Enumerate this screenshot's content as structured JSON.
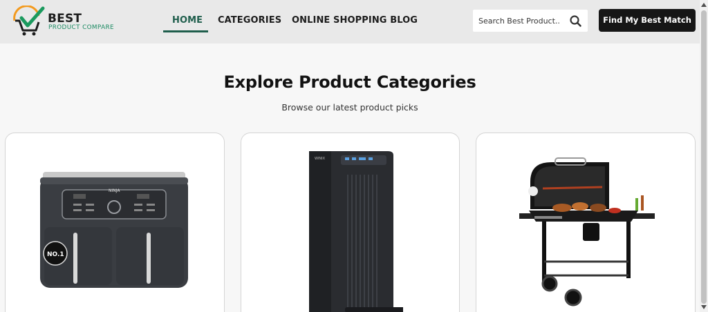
{
  "header": {
    "logo": {
      "line1": "BEST",
      "line2": "PRODUCT COMPARE"
    },
    "nav": [
      {
        "label": "HOME",
        "active": true
      },
      {
        "label": "CATEGORIES"
      },
      {
        "label": "ONLINE SHOPPING BLOG"
      }
    ],
    "search": {
      "placeholder": "Search Best Product..",
      "icon": "search-icon"
    },
    "cta_label": "Find My Best Match"
  },
  "main": {
    "title": "Explore Product Categories",
    "subtitle": "Browse our latest product picks",
    "cards": [
      {
        "image": "air-fryer-image",
        "badge": "NO.1",
        "brand": "NINJA"
      },
      {
        "image": "air-purifier-image",
        "brand": "WINIX"
      },
      {
        "image": "charcoal-grill-image"
      }
    ]
  },
  "colors": {
    "accent": "#1f5e4c",
    "cta_bg": "#161616",
    "header_bg": "#e9e9e9",
    "logo_green": "#1b8a62",
    "logo_orange": "#f39a1e"
  }
}
